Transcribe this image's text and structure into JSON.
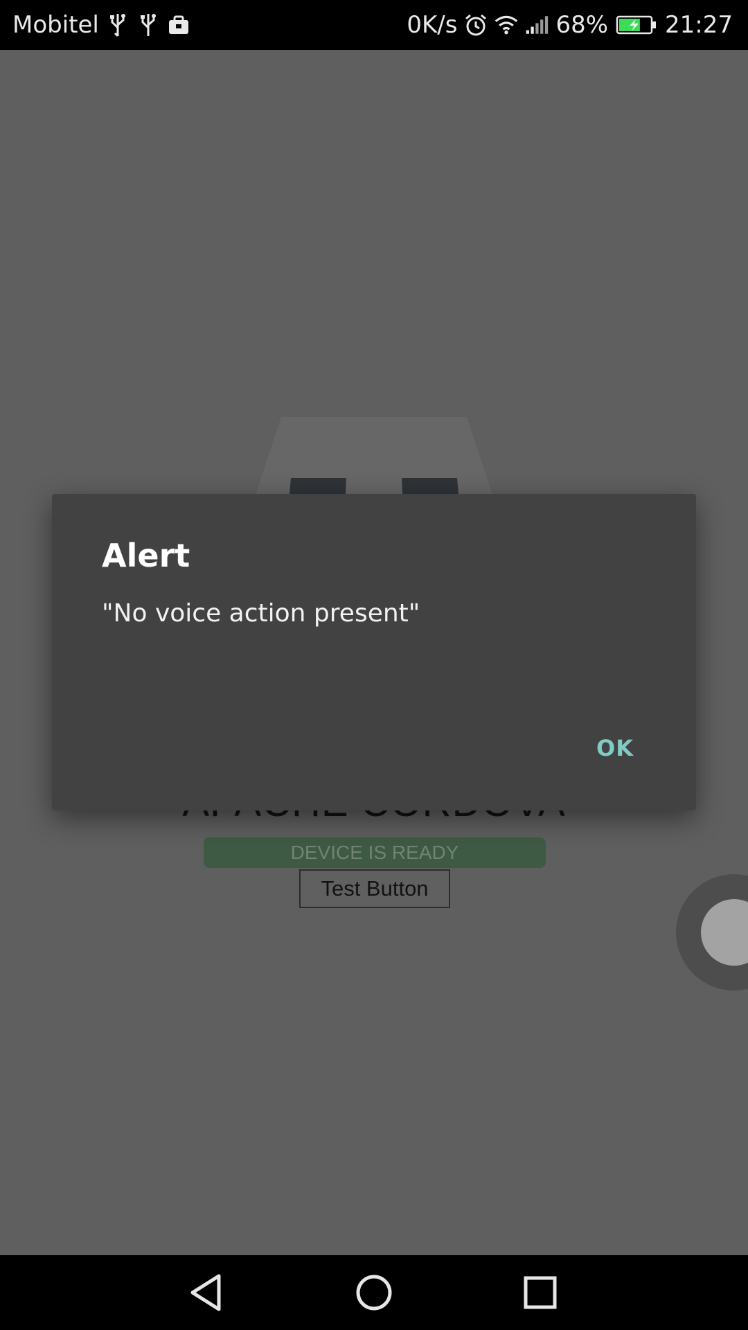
{
  "status_bar": {
    "carrier": "Mobitel",
    "net_speed": "0K/s",
    "battery_percent": "68%",
    "battery_level": 0.68,
    "time": "21:27",
    "icons": [
      "usb-icon",
      "usb-icon",
      "briefcase-icon",
      "alarm-icon",
      "wifi-icon",
      "signal-icon",
      "battery-charging-icon"
    ]
  },
  "app": {
    "title": "APACHE CORDOVA",
    "device_status": "DEVICE IS READY",
    "test_button_label": "Test Button"
  },
  "dialog": {
    "title": "Alert",
    "message": "\"No voice action present\"",
    "ok_label": "OK",
    "accent_color": "#80cbc4"
  },
  "nav_bar": {
    "icons": [
      "back-icon",
      "home-icon",
      "recents-icon"
    ]
  }
}
